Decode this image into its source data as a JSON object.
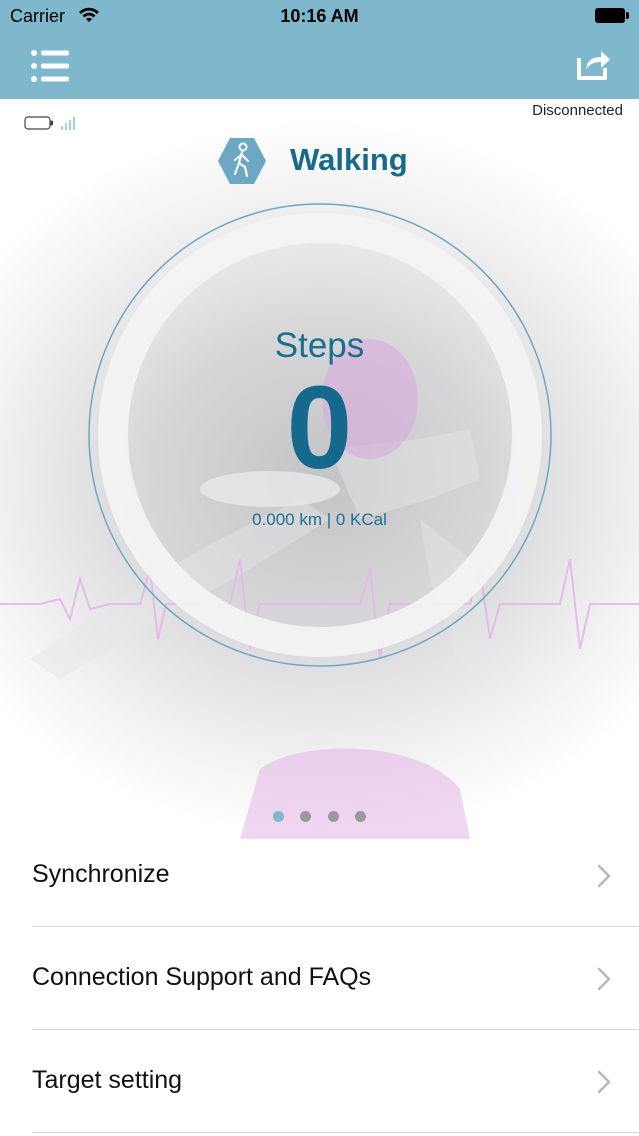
{
  "status_bar": {
    "carrier": "Carrier",
    "time": "10:16 AM"
  },
  "nav": {
    "menu_icon": "list-menu-icon",
    "share_icon": "share-icon",
    "bar_color": "#7fb7cd"
  },
  "device": {
    "connection_status": "Disconnected"
  },
  "activity": {
    "title": "Walking",
    "icon": "walking-person-icon"
  },
  "stats": {
    "label": "Steps",
    "value": "0",
    "metrics": "0.000 km | 0 KCal"
  },
  "pager": {
    "count": 4,
    "active_index": 0
  },
  "menu": {
    "items": [
      {
        "label": "Synchronize"
      },
      {
        "label": "Connection Support and FAQs"
      },
      {
        "label": "Target setting"
      }
    ]
  },
  "colors": {
    "accent": "#166b8c",
    "ring": "#6ba8c4"
  }
}
